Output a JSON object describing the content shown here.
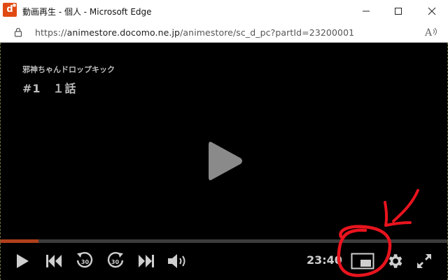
{
  "window": {
    "title": "動画再生 - 個人 - Microsoft Edge",
    "app_icon_letter": "d",
    "buttons": [
      "minimize-icon",
      "maximize-icon",
      "close-icon"
    ]
  },
  "address_bar": {
    "url_prefix": "https://",
    "url_host": "animestore.docomo.ne.jp",
    "url_path": "/animestore/sc_d_pc?partId=23200001",
    "read_aloud_label": "Aͅ"
  },
  "video": {
    "series_title": "邪神ちゃんドロップキック",
    "episode_title": "#1　１話",
    "progress_fraction": 0.086,
    "time_display": "23:40"
  },
  "controls": [
    "play-icon",
    "previous-icon",
    "rewind-30-icon",
    "forward-30-icon",
    "next-icon",
    "volume-icon",
    "picture-in-picture-icon",
    "settings-icon",
    "fullscreen-icon"
  ],
  "rewind_label": "30",
  "forward_label": "30",
  "colors": {
    "progress": "#b0401c",
    "annotation": "#e8141e",
    "app_icon": "#e04a12"
  }
}
